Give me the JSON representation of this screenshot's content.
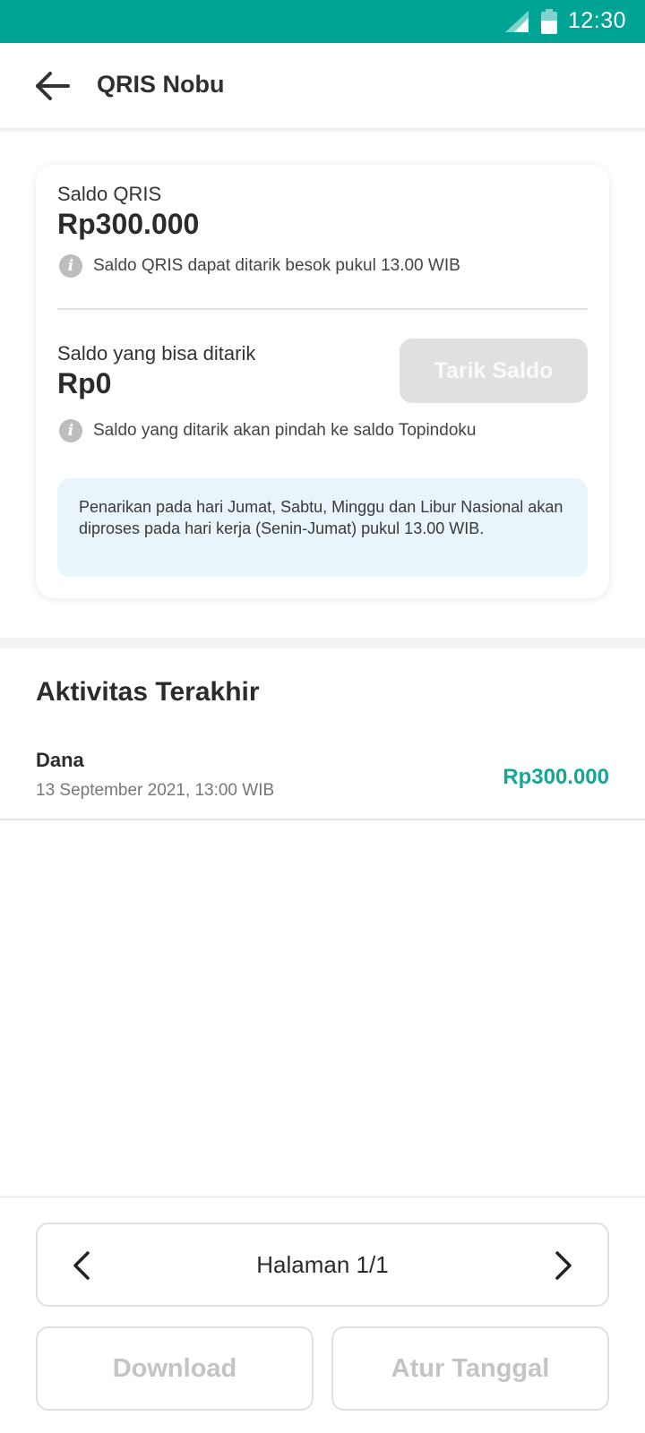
{
  "status_bar": {
    "time": "12:30"
  },
  "header": {
    "title": "QRIS Nobu"
  },
  "balance_card": {
    "qris_label": "Saldo QRIS",
    "qris_amount": "Rp300.000",
    "qris_info": "Saldo QRIS dapat ditarik besok pukul 13.00 WIB",
    "withdrawable_label": "Saldo yang bisa ditarik",
    "withdrawable_amount": "Rp0",
    "withdraw_button": "Tarik Saldo",
    "withdraw_info": "Saldo yang ditarik akan pindah ke saldo Topindoku",
    "notice": "Penarikan pada hari Jumat, Sabtu, Minggu dan Libur Nasional akan diproses pada hari kerja (Senin-Jumat) pukul 13.00 WIB."
  },
  "activity": {
    "title": "Aktivitas Terakhir",
    "items": [
      {
        "name": "Dana",
        "date": "13 September 2021, 13:00 WIB",
        "amount": "Rp300.000"
      }
    ]
  },
  "pagination": {
    "label": "Halaman 1/1"
  },
  "actions": {
    "download_label": "Download",
    "date_label": "Atur Tanggal"
  },
  "colors": {
    "primary": "#00a495",
    "amount_positive": "#16a696",
    "notice_bg": "#e9f4fb",
    "disabled": "#e0e0e0"
  },
  "icons": [
    "signal-icon",
    "battery-icon",
    "back-arrow-icon",
    "info-icon",
    "chevron-left-icon",
    "chevron-right-icon"
  ]
}
